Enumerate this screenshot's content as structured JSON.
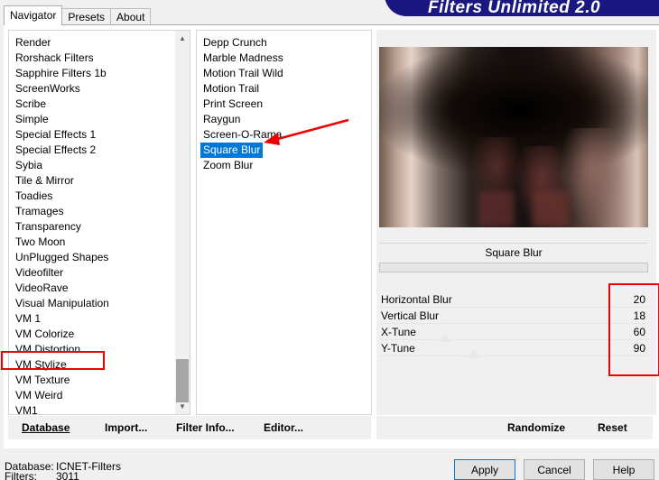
{
  "window": {
    "banner_title": "Filters Unlimited 2.0"
  },
  "tabs": [
    {
      "label": "Navigator",
      "active": true
    },
    {
      "label": "Presets",
      "active": false
    },
    {
      "label": "About",
      "active": false
    }
  ],
  "categories": {
    "items": [
      "Render",
      "Rorshack Filters",
      "Sapphire Filters 1b",
      "ScreenWorks",
      "Scribe",
      "Simple",
      "Special Effects 1",
      "Special Effects 2",
      "Sybia",
      "Tile & Mirror",
      "Toadies",
      "Tramages",
      "Transparency",
      "Two Moon",
      "UnPlugged Shapes",
      "Videofilter",
      "VideoRave",
      "Visual Manipulation",
      "VM 1",
      "VM Colorize",
      "VM Distortion",
      "VM Stylize",
      "VM Texture",
      "VM Weird",
      "VM1"
    ],
    "highlighted": "VM Stylize"
  },
  "filters": {
    "items": [
      "Depp Crunch",
      "Marble Madness",
      "Motion Trail Wild",
      "Motion Trail",
      "Print Screen",
      "Raygun",
      "Screen-O-Rama",
      "Square Blur",
      "Zoom Blur"
    ],
    "selected": "Square Blur"
  },
  "preview": {
    "filter_name": "Square Blur"
  },
  "parameters": [
    {
      "label": "Horizontal Blur",
      "value": "20"
    },
    {
      "label": "Vertical Blur",
      "value": "18"
    },
    {
      "label": "X-Tune",
      "value": "60"
    },
    {
      "label": "Y-Tune",
      "value": "90"
    }
  ],
  "buttons": {
    "database": "Database",
    "import": "Import...",
    "filter_info": "Filter Info...",
    "editor": "Editor...",
    "randomize": "Randomize",
    "reset": "Reset",
    "apply": "Apply",
    "cancel": "Cancel",
    "help": "Help"
  },
  "footer": {
    "database_label": "Database:",
    "database_value": "ICNET-Filters",
    "filters_label": "Filters:",
    "filters_value": "3011"
  },
  "colors": {
    "banner": "#1a1880",
    "selection": "#0078d7",
    "annotation": "#ee0000"
  },
  "icons": {
    "scroll_up": "chevron-up-icon",
    "scroll_down": "chevron-down-icon"
  }
}
